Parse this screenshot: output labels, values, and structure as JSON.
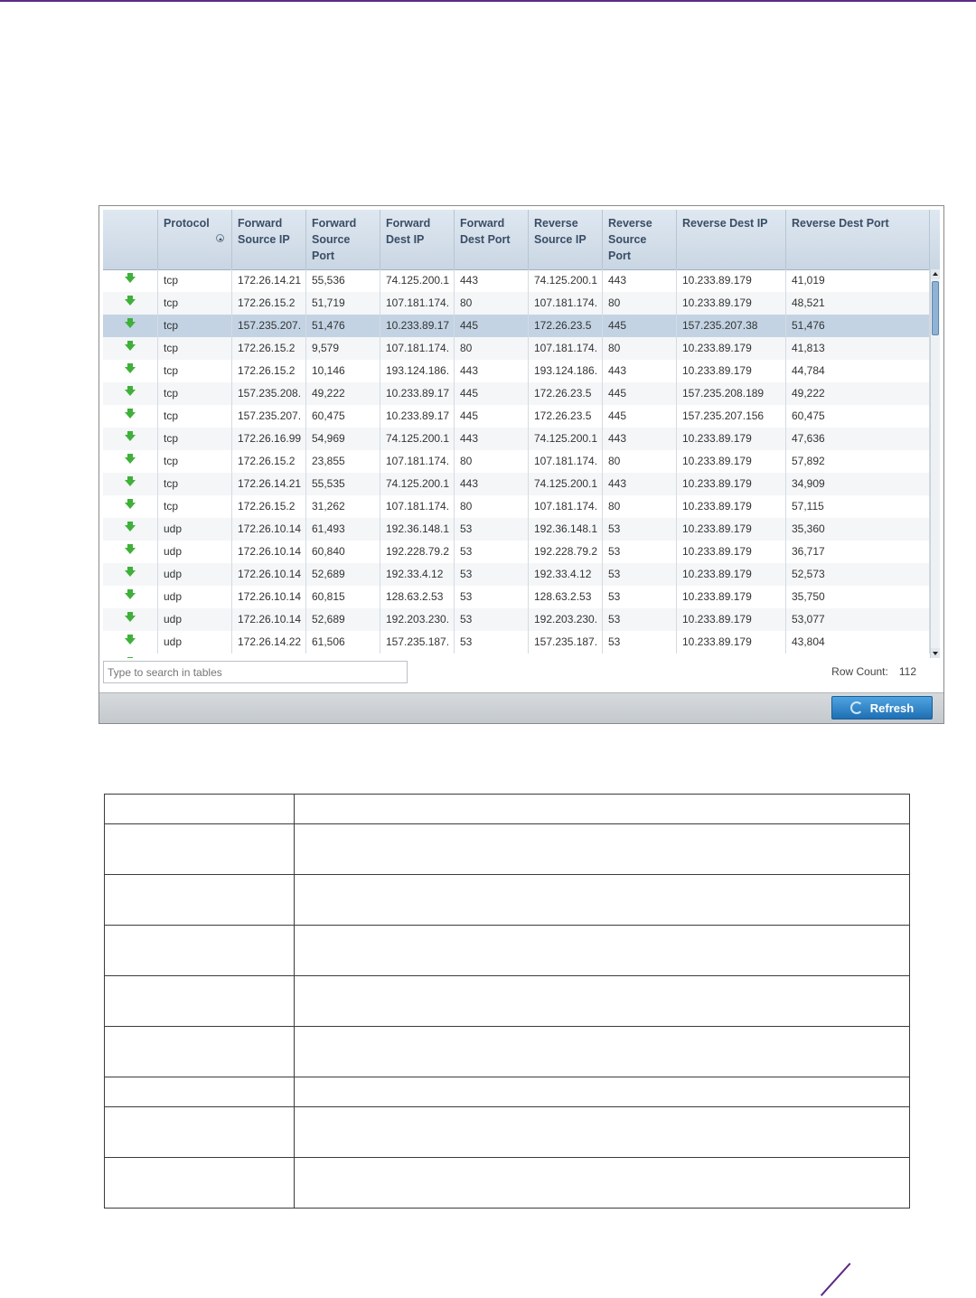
{
  "grid": {
    "columns": [
      "",
      "Protocol",
      "Forward Source IP",
      "Forward Source Port",
      "Forward Dest IP",
      "Forward Dest Port",
      "Reverse Source IP",
      "Reverse Source Port",
      "Reverse Dest IP",
      "Reverse Dest Port"
    ],
    "rows": [
      [
        "tcp",
        "172.26.14.21",
        "55,536",
        "74.125.200.1",
        "443",
        "74.125.200.1",
        "443",
        "10.233.89.179",
        "41,019"
      ],
      [
        "tcp",
        "172.26.15.2",
        "51,719",
        "107.181.174.",
        "80",
        "107.181.174.",
        "80",
        "10.233.89.179",
        "48,521"
      ],
      [
        "tcp",
        "157.235.207.",
        "51,476",
        "10.233.89.17",
        "445",
        "172.26.23.5",
        "445",
        "157.235.207.38",
        "51,476"
      ],
      [
        "tcp",
        "172.26.15.2",
        "9,579",
        "107.181.174.",
        "80",
        "107.181.174.",
        "80",
        "10.233.89.179",
        "41,813"
      ],
      [
        "tcp",
        "172.26.15.2",
        "10,146",
        "193.124.186.",
        "443",
        "193.124.186.",
        "443",
        "10.233.89.179",
        "44,784"
      ],
      [
        "tcp",
        "157.235.208.",
        "49,222",
        "10.233.89.17",
        "445",
        "172.26.23.5",
        "445",
        "157.235.208.189",
        "49,222"
      ],
      [
        "tcp",
        "157.235.207.",
        "60,475",
        "10.233.89.17",
        "445",
        "172.26.23.5",
        "445",
        "157.235.207.156",
        "60,475"
      ],
      [
        "tcp",
        "172.26.16.99",
        "54,969",
        "74.125.200.1",
        "443",
        "74.125.200.1",
        "443",
        "10.233.89.179",
        "47,636"
      ],
      [
        "tcp",
        "172.26.15.2",
        "23,855",
        "107.181.174.",
        "80",
        "107.181.174.",
        "80",
        "10.233.89.179",
        "57,892"
      ],
      [
        "tcp",
        "172.26.14.21",
        "55,535",
        "74.125.200.1",
        "443",
        "74.125.200.1",
        "443",
        "10.233.89.179",
        "34,909"
      ],
      [
        "tcp",
        "172.26.15.2",
        "31,262",
        "107.181.174.",
        "80",
        "107.181.174.",
        "80",
        "10.233.89.179",
        "57,115"
      ],
      [
        "udp",
        "172.26.10.14",
        "61,493",
        "192.36.148.1",
        "53",
        "192.36.148.1",
        "53",
        "10.233.89.179",
        "35,360"
      ],
      [
        "udp",
        "172.26.10.14",
        "60,840",
        "192.228.79.2",
        "53",
        "192.228.79.2",
        "53",
        "10.233.89.179",
        "36,717"
      ],
      [
        "udp",
        "172.26.10.14",
        "52,689",
        "192.33.4.12",
        "53",
        "192.33.4.12",
        "53",
        "10.233.89.179",
        "52,573"
      ],
      [
        "udp",
        "172.26.10.14",
        "60,815",
        "128.63.2.53",
        "53",
        "128.63.2.53",
        "53",
        "10.233.89.179",
        "35,750"
      ],
      [
        "udp",
        "172.26.10.14",
        "52,689",
        "192.203.230.",
        "53",
        "192.203.230.",
        "53",
        "10.233.89.179",
        "53,077"
      ],
      [
        "udp",
        "172.26.14.22",
        "61,506",
        "157.235.187.",
        "53",
        "157.235.187.",
        "53",
        "10.233.89.179",
        "43,804"
      ]
    ],
    "selected_row": 2
  },
  "search": {
    "placeholder": "Type to search in tables"
  },
  "row_count": {
    "label": "Row Count:",
    "value": "112"
  },
  "refresh": {
    "label": "Refresh"
  },
  "colors": {
    "header_bg": "#c9d6e3",
    "selected_row": "#c3d3e3",
    "arrow": "#3fb03a",
    "refresh": "#1f6fb4",
    "accent": "#5b2a86"
  }
}
